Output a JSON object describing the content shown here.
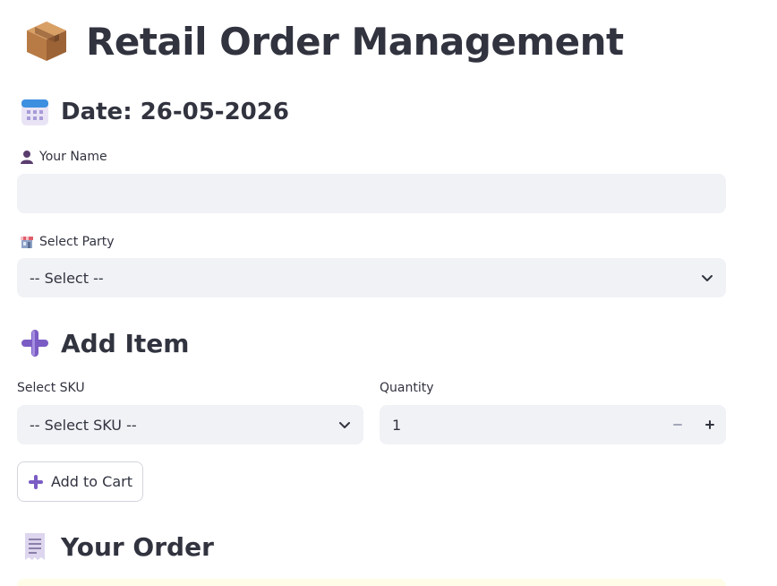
{
  "header": {
    "title": "Retail Order Management",
    "title_icon": "package-icon"
  },
  "date_section": {
    "heading": "Date: 26-05-2026",
    "icon": "calendar-icon"
  },
  "name_field": {
    "label": "Your Name",
    "icon": "user-icon",
    "value": "",
    "placeholder": ""
  },
  "party_field": {
    "label": "Select Party",
    "icon": "store-icon",
    "selected": "-- Select --"
  },
  "add_item": {
    "heading": "Add Item",
    "icon": "plus-icon",
    "sku_label": "Select SKU",
    "sku_selected": "-- Select SKU --",
    "quantity_label": "Quantity",
    "quantity_value": "1",
    "add_button_label": "Add to Cart"
  },
  "order_section": {
    "heading": "Your Order",
    "icon": "receipt-icon"
  },
  "colors": {
    "input_bg": "#f0f2f6",
    "text": "#31333f",
    "accent_purple": "#7b5cc4",
    "order_info_bg": "#fffce7"
  }
}
